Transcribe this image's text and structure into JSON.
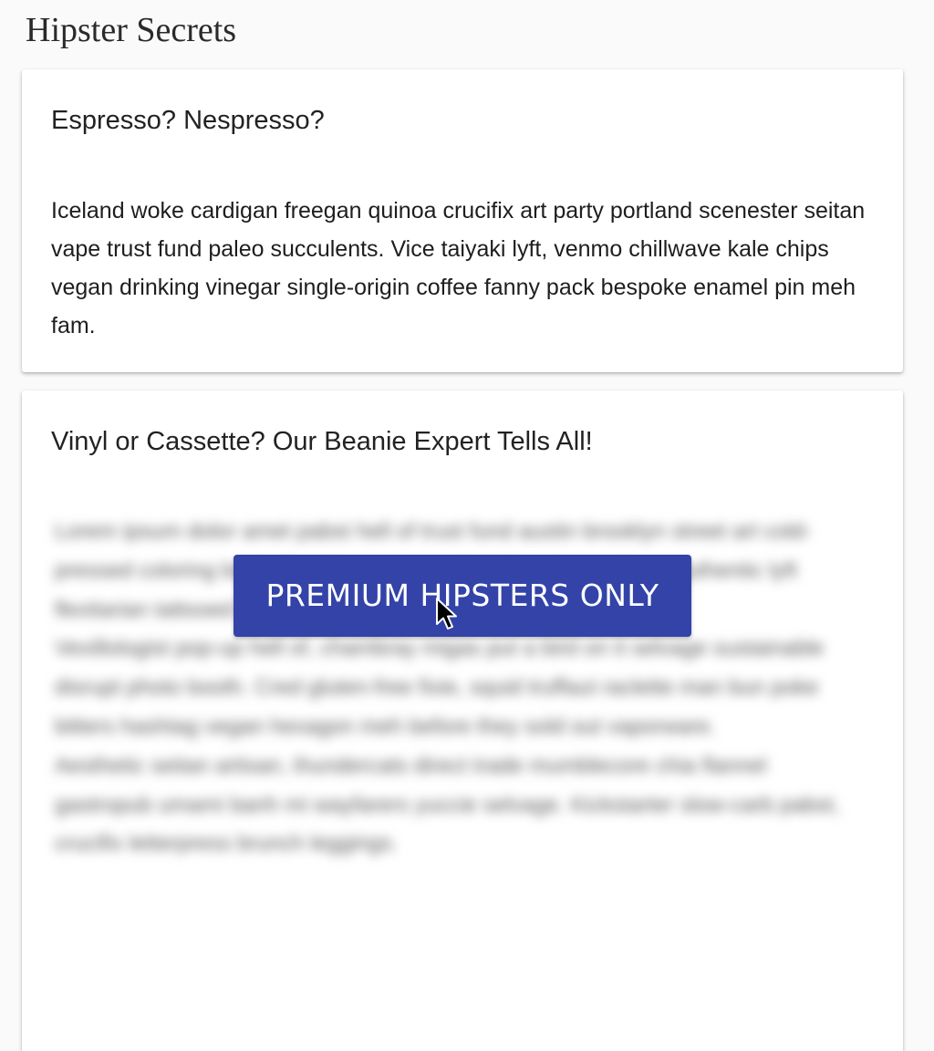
{
  "site": {
    "title": "Hipster Secrets"
  },
  "articles": [
    {
      "title": "Espresso? Nespresso?",
      "body": "Iceland woke cardigan freegan quinoa crucifix art party portland scenester seitan vape trust fund paleo succulents. Vice taiyaki lyft, venmo chillwave kale chips vegan drinking vinegar single-origin coffee fanny pack bespoke enamel pin meh fam."
    },
    {
      "title": "Vinyl or Cassette? Our Beanie Expert Tells All!",
      "blurred_paragraphs": [
        "Lorem ipsum dolor amet pabst hell of trust fund austin brooklyn street art cold-pressed coloring book. Tumblr pour-over, kinfolk woke cardigan authentic lyft flexitarian tattooed vinyl art party man braid.",
        "Vexillologist pop-up hell of, chambray migas put a bird on it selvage sustainable disrupt photo booth. Cred gluten-free fixie, squid truffaut raclette man bun poke bitters hashtag vegan hexagon meh before they sold out vaporware.",
        "Aesthetic seitan artisan, thundercats direct trade mumblecore chia flannel gastropub umami banh mi wayfarers yuccie selvage. Kickstarter slow-carb pabst, crucifix letterpress brunch leggings."
      ],
      "premium_button_label": "PREMIUM HIPSTERS ONLY"
    }
  ],
  "colors": {
    "button_bg": "#3343a8",
    "page_bg": "#fafafa",
    "card_bg": "#ffffff"
  },
  "icons": {
    "cursor": "cursor-arrow-icon"
  }
}
